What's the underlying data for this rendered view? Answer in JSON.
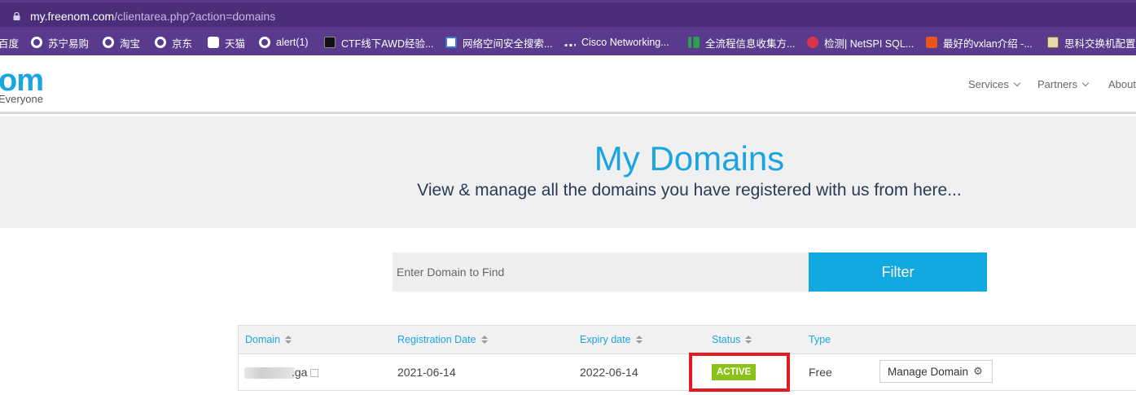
{
  "browser": {
    "url_host": "my.freenom.com",
    "url_path": "/clientarea.php?action=domains"
  },
  "bookmarks": [
    {
      "label": "百度",
      "icon": "none"
    },
    {
      "label": "苏宁易购",
      "icon": "globe-icon"
    },
    {
      "label": "淘宝",
      "icon": "globe-icon"
    },
    {
      "label": "京东",
      "icon": "globe-icon"
    },
    {
      "label": "天猫",
      "icon": "tmall-icon"
    },
    {
      "label": "alert(1)",
      "icon": "globe-icon"
    },
    {
      "label": "CTF线下AWD经验...",
      "icon": "page-icon"
    },
    {
      "label": "网络空间安全搜索...",
      "icon": "search-engine-icon"
    },
    {
      "label": "Cisco Networking...",
      "icon": "cisco-icon"
    },
    {
      "label": "全流程信息收集方...",
      "icon": "bars-icon"
    },
    {
      "label": "检测| NetSPI SQL...",
      "icon": "netspi-icon"
    },
    {
      "label": "最好的vxlan介绍 -...",
      "icon": "jian-icon"
    },
    {
      "label": "思科交换机配置",
      "icon": "book-icon"
    }
  ],
  "site": {
    "logo": "om",
    "tagline": "Everyone",
    "nav": [
      "Services",
      "Partners",
      "About"
    ]
  },
  "hero": {
    "title": "My Domains",
    "subtitle": "View & manage all the domains you have registered with us from here..."
  },
  "search": {
    "placeholder": "Enter Domain to Find",
    "filter_label": "Filter"
  },
  "table": {
    "headers": [
      "Domain",
      "Registration Date",
      "Expiry date",
      "Status",
      "Type"
    ],
    "rows": [
      {
        "domain_suffix": ".ga",
        "registration_date": "2021-06-14",
        "expiry_date": "2022-06-14",
        "status": "ACTIVE",
        "type": "Free",
        "action": "Manage Domain"
      }
    ]
  },
  "colors": {
    "browser_chrome": "#5a3a8c",
    "brand_blue": "#1ba5e0",
    "active_badge": "#8bc21a",
    "highlight_red": "#e21b23"
  }
}
